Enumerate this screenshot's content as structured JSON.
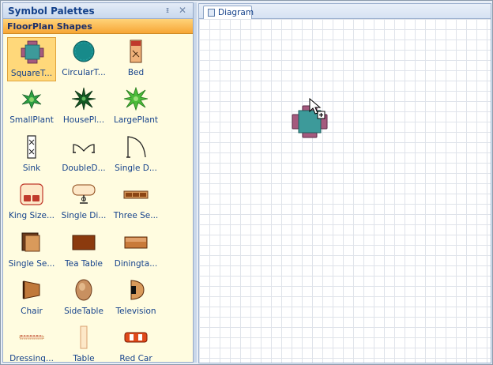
{
  "palette": {
    "title": "Symbol Palettes",
    "pin_glyph": "ᵻ",
    "close_glyph": "✕",
    "group_title": "FloorPlan Shapes",
    "items": [
      {
        "label": "SquareT...",
        "icon": "square-table-icon",
        "selected": true
      },
      {
        "label": "CircularT...",
        "icon": "circular-table-icon"
      },
      {
        "label": "Bed",
        "icon": "bed-icon"
      },
      {
        "label": "SmallPlant",
        "icon": "small-plant-icon"
      },
      {
        "label": "HousePl...",
        "icon": "house-plant-icon"
      },
      {
        "label": "LargePlant",
        "icon": "large-plant-icon"
      },
      {
        "label": "Sink",
        "icon": "sink-icon"
      },
      {
        "label": "DoubleD...",
        "icon": "double-door-icon"
      },
      {
        "label": "Single D...",
        "icon": "single-door-icon"
      },
      {
        "label": "King Size...",
        "icon": "king-size-bed-icon"
      },
      {
        "label": "Single Di...",
        "icon": "single-dining-icon"
      },
      {
        "label": "Three Se...",
        "icon": "three-seater-icon"
      },
      {
        "label": "Single Se...",
        "icon": "single-seater-icon"
      },
      {
        "label": "Tea Table",
        "icon": "tea-table-icon"
      },
      {
        "label": "Diningta...",
        "icon": "dining-table-icon"
      },
      {
        "label": "Chair",
        "icon": "chair-icon"
      },
      {
        "label": "SideTable",
        "icon": "side-table-icon"
      },
      {
        "label": "Television",
        "icon": "television-icon"
      },
      {
        "label": "Dressing...",
        "icon": "dressing-table-icon"
      },
      {
        "label": "Table",
        "icon": "table-icon"
      },
      {
        "label": "Red Car",
        "icon": "red-car-icon"
      }
    ]
  },
  "diagram": {
    "tab_label": "Diagram"
  },
  "colors": {
    "palette_bg": "#fffce0",
    "group_header": "#f7a635",
    "selection": "#ffd87a",
    "table_teal": "#3d9a9a",
    "chair_plum": "#a55a7e",
    "wood_brown": "#8b4513"
  }
}
